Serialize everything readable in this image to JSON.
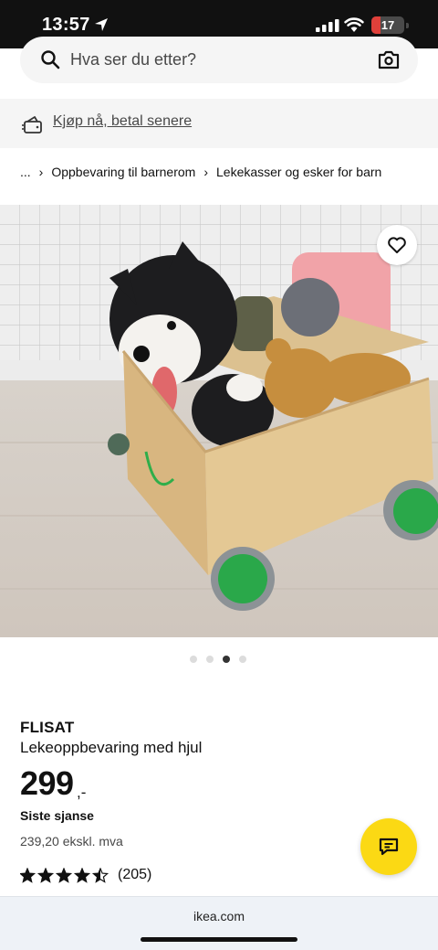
{
  "status_bar": {
    "time": "13:57",
    "battery": "17"
  },
  "search": {
    "placeholder": "Hva ser du etter?"
  },
  "promo": {
    "label": "Kjøp nå, betal senere"
  },
  "breadcrumb": [
    "...",
    "Oppbevaring til barnerom",
    "Lekekasser og esker for barn"
  ],
  "carousel": {
    "count": 4,
    "active_index": 2
  },
  "product": {
    "brand": "FLISAT",
    "description": "Lekeoppbevaring med hjul",
    "price": "299",
    "price_suffix": ",-",
    "badge": "Siste sjanse",
    "ex_vat": "239,20 ekskl. mva",
    "rating": 4.5,
    "review_count": "(205)"
  },
  "browser": {
    "url": "ikea.com"
  },
  "colors": {
    "chat_button": "#fbd914",
    "battery_low": "#e0403a"
  }
}
